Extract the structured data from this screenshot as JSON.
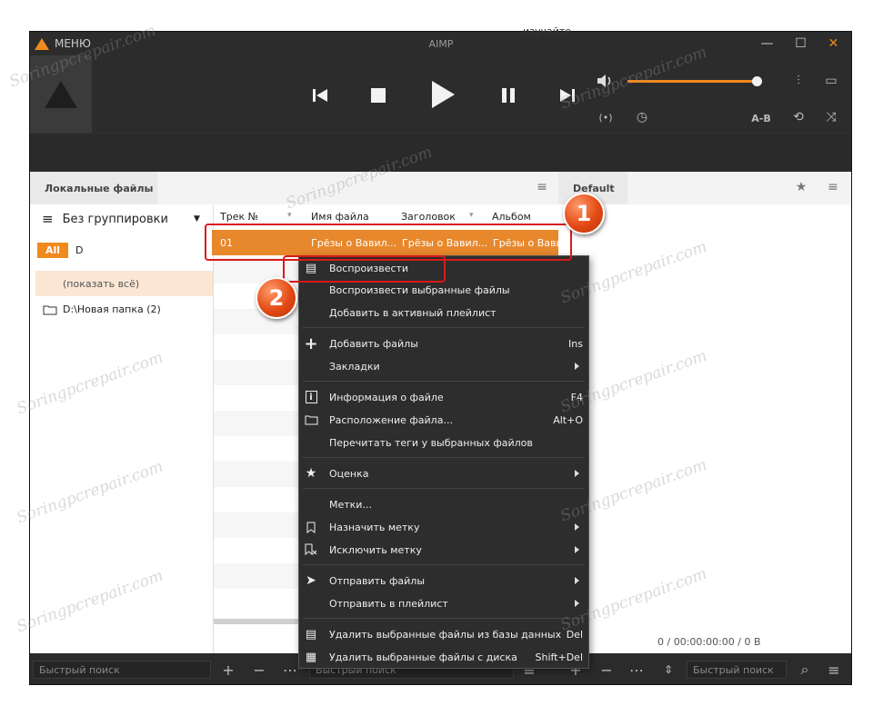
{
  "window": {
    "menu_label": "МЕНЮ",
    "title": "AIMP",
    "behind_text": "изучайте"
  },
  "player": {
    "ab_label": "A-B",
    "volume_level": 0.95
  },
  "tabs": {
    "left": "Локальные файлы",
    "right": "Default"
  },
  "library": {
    "grouping": "Без группировки",
    "filter_all": "All",
    "filter_letter": "D",
    "show_all": "(показать всё)",
    "folder": "D:\\Новая папка (2)"
  },
  "columns": [
    "Трек №",
    "Имя файла",
    "Заголовок",
    "Альбом"
  ],
  "selected_row": {
    "track": "01",
    "filename": "Грёзы о Вавил...",
    "title": "Грёзы о Вавил...",
    "album": "Грёзы о Вавил"
  },
  "playlist_status": "0 / 00:00:00:00 / 0 B",
  "search": {
    "left": "Быстрый поиск",
    "center": "Быстрый поиск",
    "right": "Быстрый поиск"
  },
  "context_menu": [
    {
      "icon": "play-list-icon",
      "label": "Воспроизвести",
      "shortcut": ""
    },
    {
      "icon": "",
      "label": "Воспроизвести выбранные файлы",
      "shortcut": ""
    },
    {
      "icon": "",
      "label": "Добавить в активный плейлист",
      "shortcut": ""
    },
    {
      "icon": "plus-icon",
      "label": "Добавить файлы",
      "shortcut": "Ins"
    },
    {
      "icon": "",
      "label": "Закладки",
      "shortcut": ""
    },
    {
      "icon": "info-icon",
      "label": "Информация о файле",
      "shortcut": "F4"
    },
    {
      "icon": "folder-icon",
      "label": "Расположение файла...",
      "shortcut": "Alt+O"
    },
    {
      "icon": "",
      "label": "Перечитать теги у выбранных файлов",
      "shortcut": ""
    },
    {
      "icon": "star-icon",
      "label": "Оценка",
      "shortcut": ""
    },
    {
      "icon": "",
      "label": "Метки...",
      "shortcut": ""
    },
    {
      "icon": "bookmark-icon",
      "label": "Назначить метку",
      "shortcut": ""
    },
    {
      "icon": "bookmark-remove-icon",
      "label": "Исключить метку",
      "shortcut": ""
    },
    {
      "icon": "send-icon",
      "label": "Отправить файлы",
      "shortcut": ""
    },
    {
      "icon": "",
      "label": "Отправить в плейлист",
      "shortcut": ""
    },
    {
      "icon": "remove-db-icon",
      "label": "Удалить выбранные файлы из базы данных",
      "shortcut": "Del"
    },
    {
      "icon": "delete-disk-icon",
      "label": "Удалить выбранные файлы с диска",
      "shortcut": "Shift+Del"
    }
  ],
  "annotations": {
    "step1": "1",
    "step2": "2"
  },
  "watermark": "Soringpcrepair.com"
}
